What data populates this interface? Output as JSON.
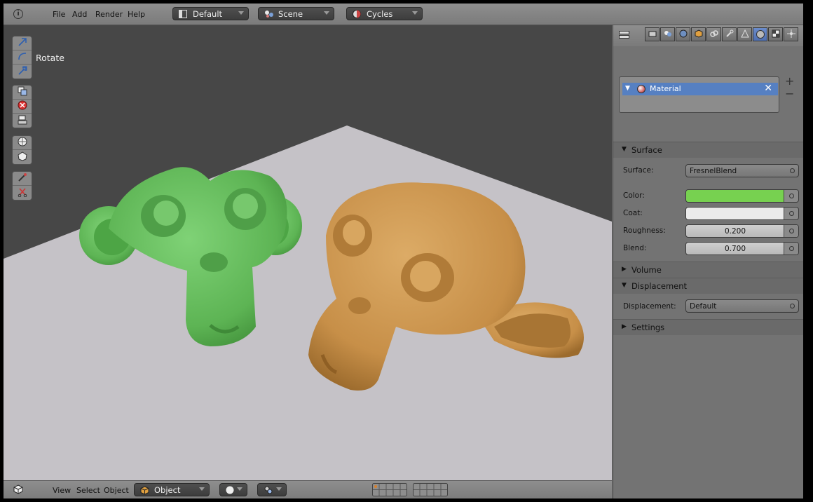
{
  "menu": [
    "File",
    "Add",
    "Render",
    "Help"
  ],
  "header": {
    "layout": "Default",
    "scene": "Scene",
    "engine": "Cycles"
  },
  "viewport": {
    "operator_label": "Rotate"
  },
  "bottombar": {
    "menu": [
      "View",
      "Select",
      "Object"
    ],
    "mode": "Object"
  },
  "properties": {
    "slot_name": "Material",
    "sections": {
      "surface": "Surface",
      "volume": "Volume",
      "displacement": "Displacement",
      "settings": "Settings"
    },
    "surface_label": "Surface:",
    "surface_value": "FresnelBlend",
    "color_label": "Color:",
    "coat_label": "Coat:",
    "roughness_label": "Roughness:",
    "roughness_value": "0.200",
    "blend_label": "Blend:",
    "blend_value": "0.700",
    "displacement_label": "Displacement:",
    "displacement_value": "Default"
  },
  "colors": {
    "color_swatch": "#77d150",
    "coat_swatch": "#ebebeb",
    "green_monkey": "#5fba55",
    "orange_monkey": "#c9954e",
    "floor": "#c5c2c7",
    "selection": "#5680c2"
  },
  "icons": {
    "info": "info-icon",
    "layout": "layout-icon",
    "scene": "scene-icon",
    "engine": "render-engine-icon"
  }
}
